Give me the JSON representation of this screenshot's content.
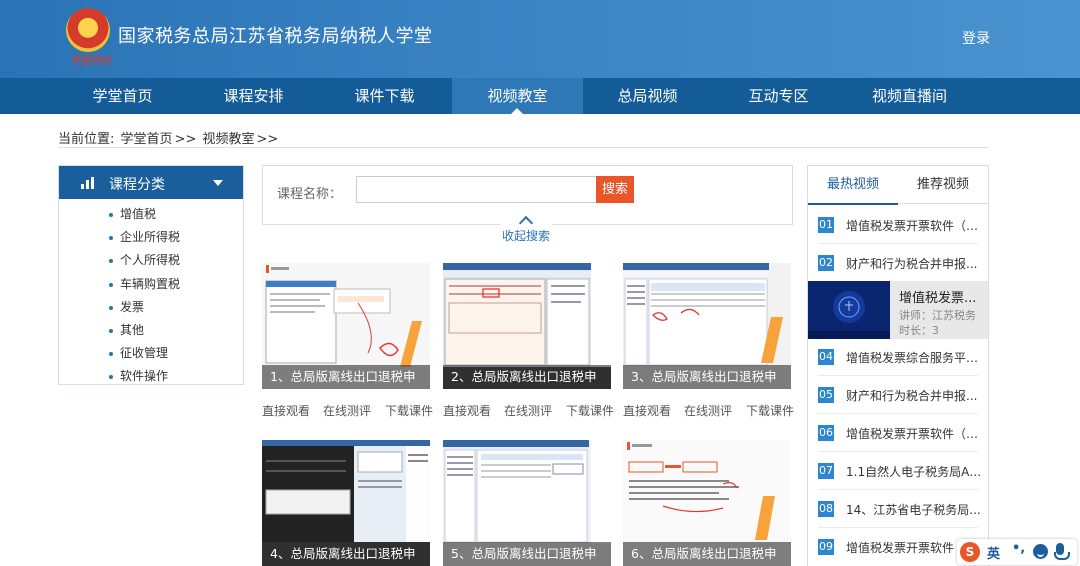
{
  "header": {
    "site_title": "国家税务总局江苏省税务局纳税人学堂",
    "emblem_script": "学堂培训",
    "login_label": "登录"
  },
  "nav": {
    "items": [
      {
        "label": "学堂首页"
      },
      {
        "label": "课程安排"
      },
      {
        "label": "课件下载"
      },
      {
        "label": "视频教室",
        "active": true
      },
      {
        "label": "总局视频"
      },
      {
        "label": "互动专区"
      },
      {
        "label": "视频直播间"
      }
    ]
  },
  "breadcrumb": {
    "prefix": "当前位置:",
    "home": "学堂首页",
    "sep": ">>",
    "current": "视频教室"
  },
  "category": {
    "title": "课程分类",
    "items": [
      "增值税",
      "企业所得税",
      "个人所得税",
      "车辆购置税",
      "发票",
      "其他",
      "征收管理",
      "软件操作"
    ]
  },
  "search": {
    "label": "课程名称：",
    "value": "",
    "button": "搜索",
    "collapse_label": "收起搜索"
  },
  "videos": [
    {
      "title": "1、总局版离线出口退税申",
      "actions": [
        "直接观看",
        "在线测评",
        "下载课件"
      ]
    },
    {
      "title": "2、总局版离线出口退税申",
      "actions": [
        "直接观看",
        "在线测评",
        "下载课件"
      ]
    },
    {
      "title": "3、总局版离线出口退税申",
      "actions": [
        "直接观看",
        "在线测评",
        "下载课件"
      ]
    },
    {
      "title": "4、总局版离线出口退税申"
    },
    {
      "title": "5、总局版离线出口退税申"
    },
    {
      "title": "6、总局版离线出口退税申"
    }
  ],
  "right_panel": {
    "tabs": [
      {
        "label": "最热视频",
        "active": true
      },
      {
        "label": "推荐视频"
      }
    ],
    "rank": [
      {
        "num": "01",
        "text": "增值税发票开票软件（税..."
      },
      {
        "num": "02",
        "text": "财产和行为税合并申报..."
      },
      {
        "num": "04",
        "text": "增值税发票综合服务平台..."
      },
      {
        "num": "05",
        "text": "财产和行为税合并申报..."
      },
      {
        "num": "06",
        "text": "增值税发票开票软件（税..."
      },
      {
        "num": "07",
        "text": "1.1自然人电子税务局AP..."
      },
      {
        "num": "08",
        "text": "14、江苏省电子税务局..."
      },
      {
        "num": "09",
        "text": "增值税发票开票软件（"
      }
    ],
    "featured": {
      "title": "增值税发票...",
      "teacher": "讲师：江苏税务",
      "duration": "时长：3"
    }
  },
  "ime": {
    "logo": "S",
    "lang": "英",
    "punct": "•,"
  },
  "colors": {
    "header_blue": "#2a73b5",
    "nav_blue": "#145c98",
    "accent_orange": "#e8562a",
    "rank_blue": "#2e86d1"
  }
}
